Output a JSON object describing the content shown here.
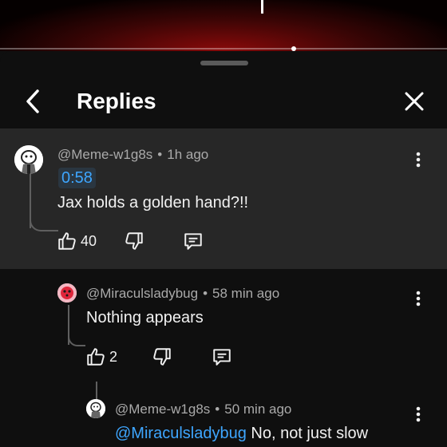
{
  "header": {
    "title": "Replies"
  },
  "comments": [
    {
      "handle": "@Meme-w1g8s",
      "separator": "•",
      "time": "1h ago",
      "timestamp_link": "0:58",
      "text": "Jax holds a golden hand?!!",
      "likes": "40"
    },
    {
      "handle": "@Miraculsladybug",
      "separator": "•",
      "time": "58 min ago",
      "text": "Nothing appears",
      "likes": "2"
    },
    {
      "handle": "@Meme-w1g8s",
      "separator": "•",
      "time": "50 min ago",
      "mention": "@Miraculsladybug",
      "text": " No, not just slow"
    }
  ],
  "colors": {
    "background": "#0f0f0f",
    "highlight": "#272727",
    "link": "#3ea6ff",
    "meta": "#aaaaaa",
    "text": "#f1f1f1"
  },
  "icons": [
    "back-arrow-icon",
    "close-icon",
    "more-vert-icon",
    "thumb-up-icon",
    "thumb-down-icon",
    "reply-comment-icon"
  ]
}
